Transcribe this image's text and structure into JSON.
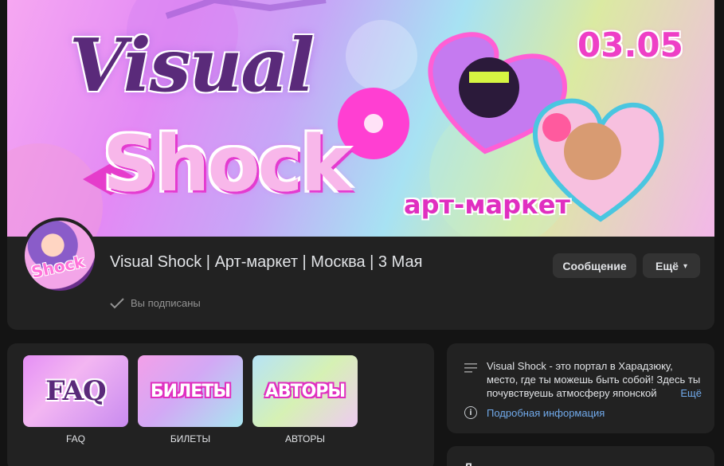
{
  "group": {
    "name": "Visual Shock | Арт-маркет | Москва | 3 Мая",
    "subscription_status": "Вы подписаны",
    "avatar_text": "Shock"
  },
  "cover": {
    "title_top": "Visual",
    "title_bottom": "Shock",
    "date": "03.05",
    "subtitle": "арт-маркет"
  },
  "actions": {
    "message_label": "Сообщение",
    "more_label": "Ещё"
  },
  "links": [
    {
      "thumb_text": "FAQ",
      "label": "FAQ"
    },
    {
      "thumb_text": "БИЛЕТЫ",
      "label": "БИЛЕТЫ"
    },
    {
      "thumb_text": "АВТОРЫ",
      "label": "АВТОРЫ"
    }
  ],
  "info": {
    "description": "Visual Shock - это портал в Харадзюку, место, где ты можешь быть собой! Здесь ты почувствуешь атмосферу японской альтернативной моды",
    "more_link": "Ещё",
    "details_link": "Подробная информация"
  },
  "next_section": {
    "title": "Л"
  },
  "colors": {
    "page_bg": "#141414",
    "card_bg": "#222222",
    "button_bg": "#333333",
    "link": "#71aaeb",
    "text_primary": "#e1e3e6",
    "text_secondary": "#939393",
    "accent_pink": "#e02fc0"
  }
}
